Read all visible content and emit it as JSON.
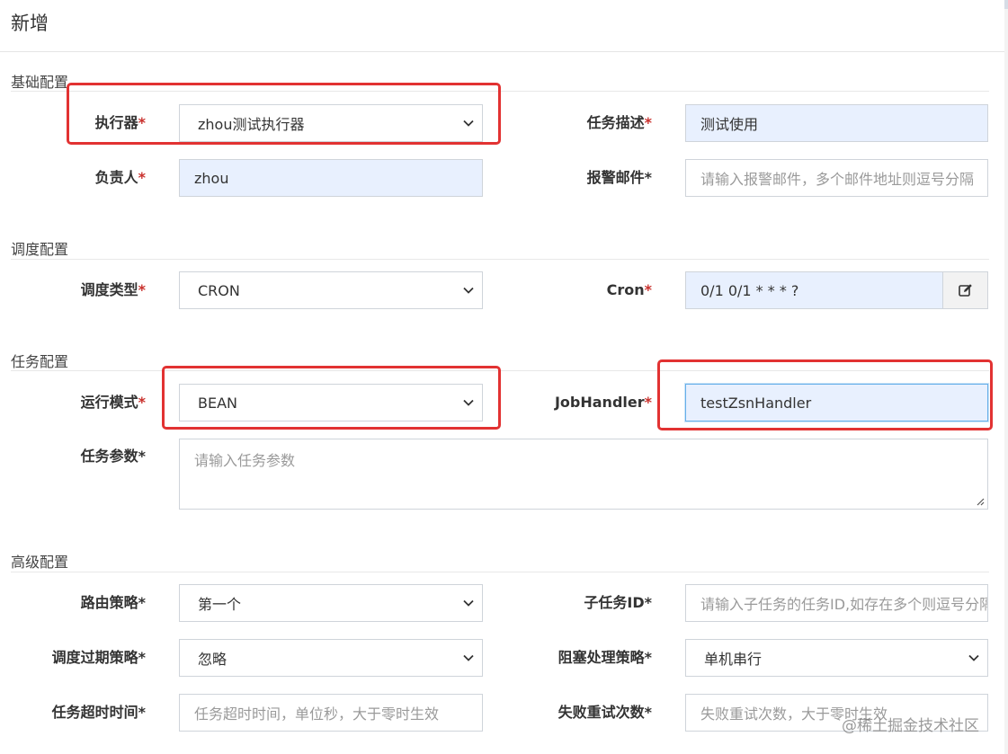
{
  "modal": {
    "title": "新增"
  },
  "required_mark": "*",
  "sections": {
    "basic": "基础配置",
    "schedule": "调度配置",
    "task": "任务配置",
    "advanced": "高级配置"
  },
  "fields": {
    "executor": {
      "label": "执行器",
      "value": "zhou测试执行器"
    },
    "task_desc": {
      "label": "任务描述",
      "value": "测试使用"
    },
    "owner": {
      "label": "负责人",
      "value": "zhou"
    },
    "alarm_email": {
      "label": "报警邮件",
      "placeholder": "请输入报警邮件，多个邮件地址则逗号分隔"
    },
    "schedule_type": {
      "label": "调度类型",
      "value": "CRON"
    },
    "cron": {
      "label": "Cron",
      "value": "0/1 0/1 * * * ?"
    },
    "run_mode": {
      "label": "运行模式",
      "value": "BEAN"
    },
    "job_handler": {
      "label": "JobHandler",
      "value": "testZsnHandler"
    },
    "task_param": {
      "label": "任务参数",
      "placeholder": "请输入任务参数"
    },
    "route_strategy": {
      "label": "路由策略",
      "value": "第一个"
    },
    "child_job_id": {
      "label": "子任务ID",
      "placeholder": "请输入子任务的任务ID,如存在多个则逗号分隔"
    },
    "misfire_strategy": {
      "label": "调度过期策略",
      "value": "忽略"
    },
    "block_strategy": {
      "label": "阻塞处理策略",
      "value": "单机串行"
    },
    "timeout": {
      "label": "任务超时时间",
      "placeholder": "任务超时时间，单位秒，大于零时生效"
    },
    "fail_retry": {
      "label": "失败重试次数",
      "placeholder": "失败重试次数，大于零时生效"
    }
  },
  "watermark": "@稀土掘金技术社区",
  "colors": {
    "highlight": "#e23232",
    "autofill": "#e8f0fe",
    "required": "#c9302c"
  },
  "icons": {
    "select_arrow": "chevron-down-icon",
    "cron_edit": "edit-icon",
    "resize": "resize-grip-icon"
  }
}
